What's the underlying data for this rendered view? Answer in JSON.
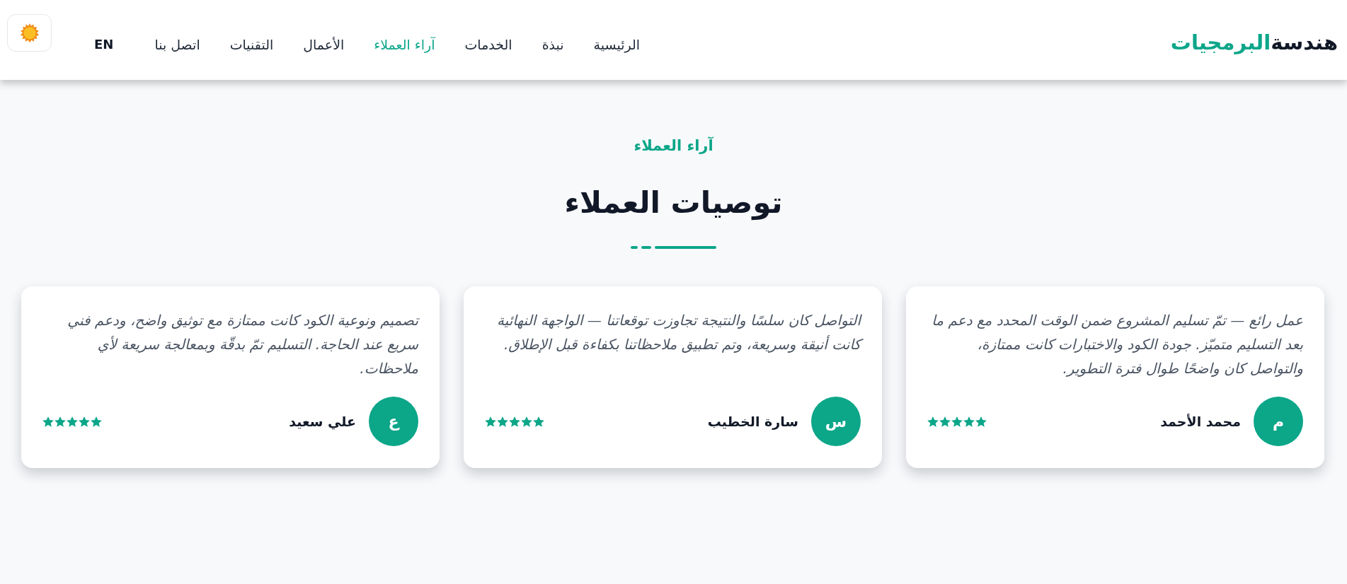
{
  "header": {
    "logo": {
      "primary": "هندسة",
      "accent": "البرمجيات"
    },
    "nav": [
      {
        "label": "الرئيسية",
        "selected": false
      },
      {
        "label": "نبذة",
        "selected": false
      },
      {
        "label": "الخدمات",
        "selected": false
      },
      {
        "label": "آراء العملاء",
        "selected": true
      },
      {
        "label": "الأعمال",
        "selected": false
      },
      {
        "label": "التقنيات",
        "selected": false
      },
      {
        "label": "اتصل بنا",
        "selected": false
      }
    ],
    "language": "EN"
  },
  "section": {
    "eyebrow": "آراء العملاء",
    "title": "توصيات العملاء"
  },
  "testimonials": [
    {
      "quote": "عمل رائع — تمّ تسليم المشروع ضمن الوقت المحدد مع دعم ما بعد التسليم متميّز. جودة الكود والاختبارات كانت ممتازة، والتواصل كان واضحًا طوال فترة التطوير.",
      "initial": "م",
      "name": "محمد الأحمد",
      "stars": 5
    },
    {
      "quote": "التواصل كان سلسًا والنتيجة تجاوزت توقعاتنا — الواجهة النهائية كانت أنيقة وسريعة، وتم تطبيق ملاحظاتنا بكفاءة قبل الإطلاق.",
      "initial": "س",
      "name": "سارة الخطيب",
      "stars": 5
    },
    {
      "quote": "تصميم ونوعية الكود كانت ممتازة مع توثيق واضح، ودعم فني سريع عند الحاجة. التسليم تمّ بدقّة وبمعالجة سريعة لأي ملاحظات.",
      "initial": "ع",
      "name": "علي سعيد",
      "stars": 5
    }
  ]
}
